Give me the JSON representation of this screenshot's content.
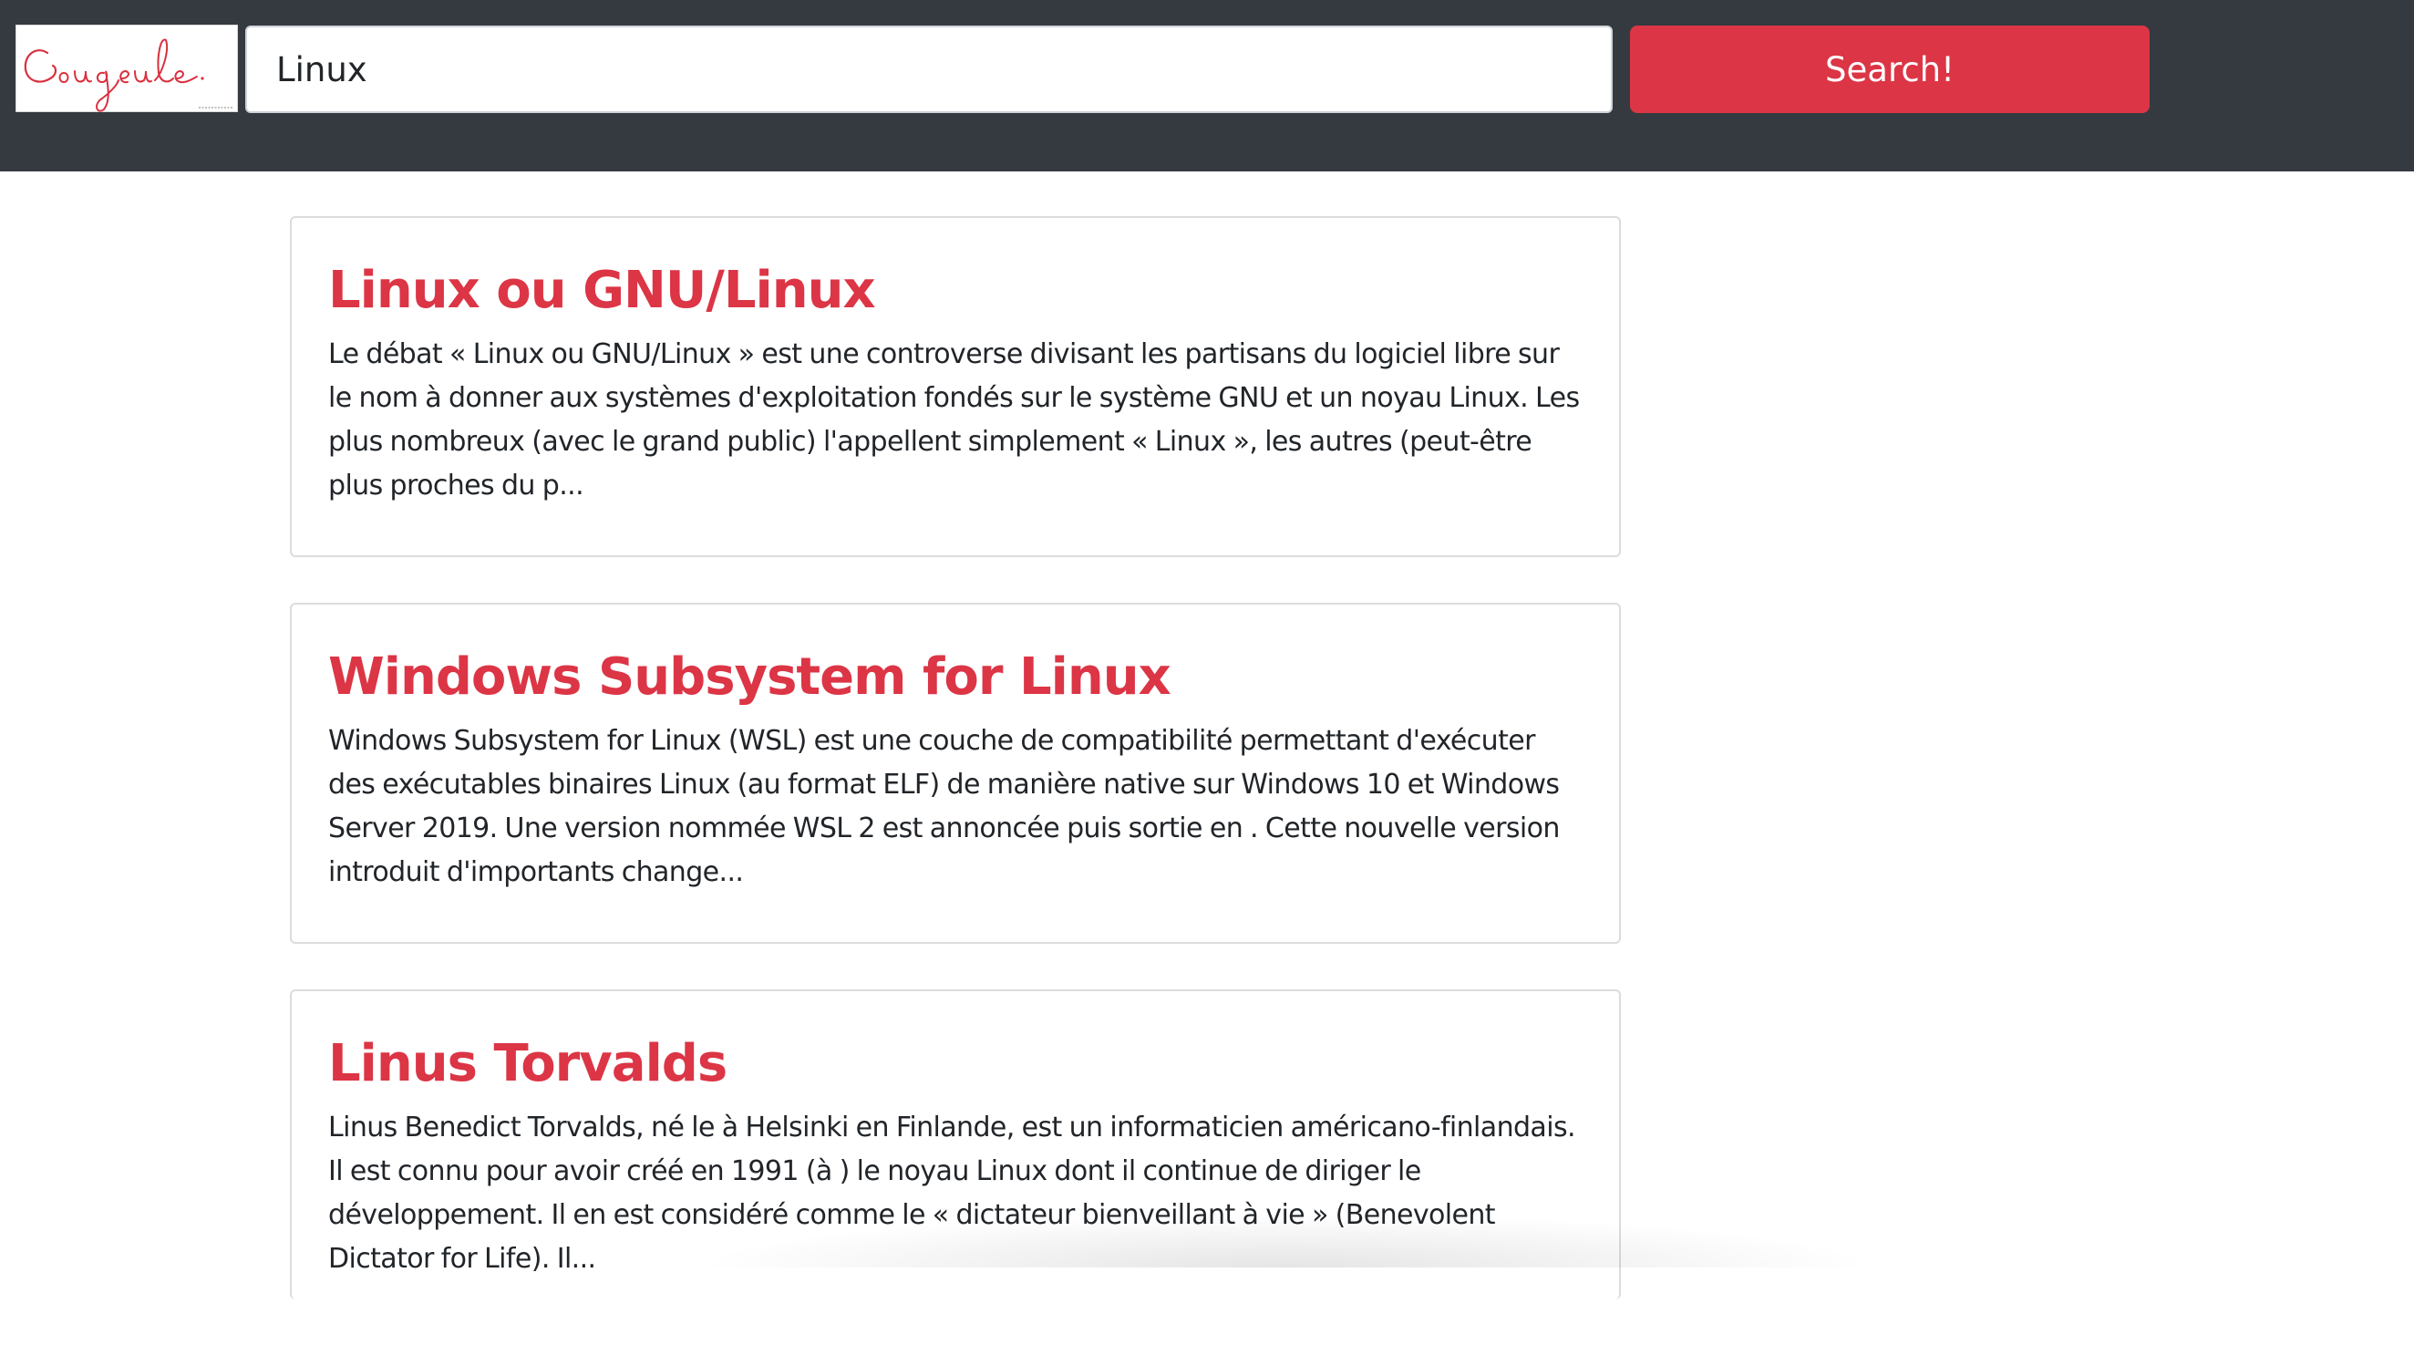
{
  "header": {
    "logo": {
      "brand_text": "Gougeule",
      "icon": "handwritten-logo"
    },
    "search": {
      "value": "Linux",
      "placeholder": ""
    },
    "search_button_label": "Search!"
  },
  "colors": {
    "header_bg": "#343a40",
    "accent": "#dc3545",
    "text": "#212529"
  },
  "results": [
    {
      "title": "Linux ou GNU/Linux",
      "snippet": "Le débat « Linux ou GNU/Linux » est une controverse divisant les partisans du logiciel libre sur le nom à donner aux systèmes d'exploitation fondés sur le système GNU et un noyau Linux. Les plus nombreux (avec le grand public) l'appellent simplement « Linux », les autres (peut-être plus proches du p..."
    },
    {
      "title": "Windows Subsystem for Linux",
      "snippet": "Windows Subsystem for Linux (WSL) est une couche de compatibilité permettant d'exécuter des exécutables binaires Linux (au format ELF) de manière native sur Windows 10 et Windows Server 2019. Une version nommée WSL 2 est annoncée puis sortie en . Cette nouvelle version introduit d'importants change..."
    },
    {
      "title": "Linus Torvalds",
      "snippet": "Linus Benedict Torvalds, né le à Helsinki en Finlande, est un informaticien américano-finlandais. Il est connu pour avoir créé en 1991 (à ) le noyau Linux dont il continue de diriger le développement. Il en est considéré comme le « dictateur bienveillant à vie » (Benevolent Dictator for Life). Il..."
    }
  ]
}
